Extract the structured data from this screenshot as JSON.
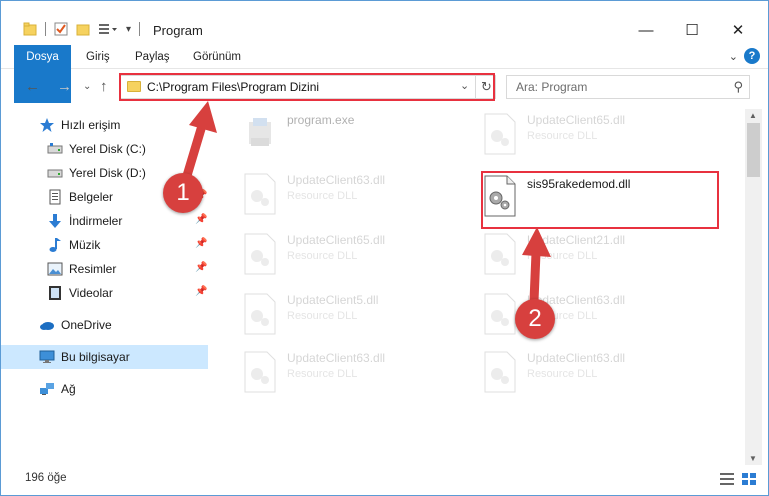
{
  "window": {
    "title": "Program",
    "controls": {
      "minimize": "—",
      "maximize": "☐",
      "close": "✕"
    }
  },
  "ribbon": {
    "tabs": [
      "Dosya",
      "Giriş",
      "Paylaş",
      "Görünüm"
    ],
    "help": "?"
  },
  "navigation": {
    "address": "C:\\Program Files\\Program Dizini",
    "search_placeholder": "Ara: Program"
  },
  "sidebar": {
    "items": [
      {
        "label": "Hızlı erişim",
        "icon": "star-icon"
      },
      {
        "label": "Yerel Disk (C:)",
        "icon": "drive-icon",
        "pinned": true
      },
      {
        "label": "Yerel Disk (D:)",
        "icon": "drive-icon",
        "pinned": true
      },
      {
        "label": "Belgeler",
        "icon": "documents-icon",
        "pinned": true
      },
      {
        "label": "İndirmeler",
        "icon": "download-icon",
        "pinned": true
      },
      {
        "label": "Müzik",
        "icon": "music-icon",
        "pinned": true
      },
      {
        "label": "Resimler",
        "icon": "pictures-icon",
        "pinned": true
      },
      {
        "label": "Videolar",
        "icon": "videos-icon",
        "pinned": true
      },
      {
        "label": "OneDrive",
        "icon": "cloud-icon"
      },
      {
        "label": "Bu bilgisayar",
        "icon": "computer-icon",
        "selected": true
      },
      {
        "label": "Ağ",
        "icon": "network-icon"
      }
    ]
  },
  "files": [
    {
      "name": "program.exe",
      "type": ""
    },
    {
      "name": "UpdateClient65.dll",
      "type": "Resource DLL"
    },
    {
      "name": "UpdateClient63.dll",
      "type": "Resource DLL"
    },
    {
      "name": "sis95rakedemod.dll",
      "type": ""
    },
    {
      "name": "UpdateClient65.dll",
      "type": "Resource DLL"
    },
    {
      "name": "UpdateClient21.dll",
      "type": "Resource DLL"
    },
    {
      "name": "UpdateClient5.dll",
      "type": "Resource DLL"
    },
    {
      "name": "UpdateClient63.dll",
      "type": "Resource DLL"
    },
    {
      "name": "UpdateClient63.dll",
      "type": "Resource DLL"
    },
    {
      "name": "UpdateClient63.dll",
      "type": "Resource DLL"
    }
  ],
  "status": {
    "item_count": "196 öğe"
  },
  "annotations": {
    "step1": "1",
    "step2": "2"
  },
  "colors": {
    "accent": "#1979ca",
    "highlight": "#e8313f",
    "badge": "#d7403e",
    "selected_bg": "#cce8ff"
  }
}
